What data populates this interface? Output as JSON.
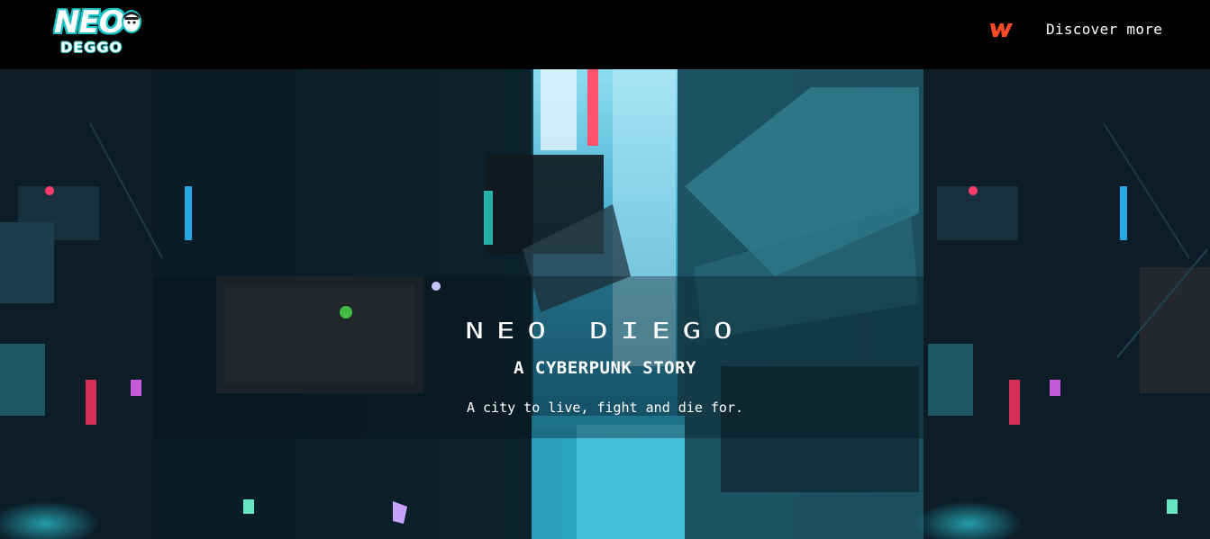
{
  "header": {
    "logo": {
      "top": "NEO",
      "bottom": "DEGGO"
    },
    "w_icon": "w-logo-icon",
    "discover_label": "Discover more"
  },
  "hero": {
    "title": "NEO DIEGO",
    "subtitle": "A CYBERPUNK STORY",
    "tagline": "A city to live, fight and die for."
  },
  "colors": {
    "background": "#000000",
    "logo_accent": "#18c6c9",
    "w_icon": "#ff4a2a",
    "text": "#ffffff"
  }
}
